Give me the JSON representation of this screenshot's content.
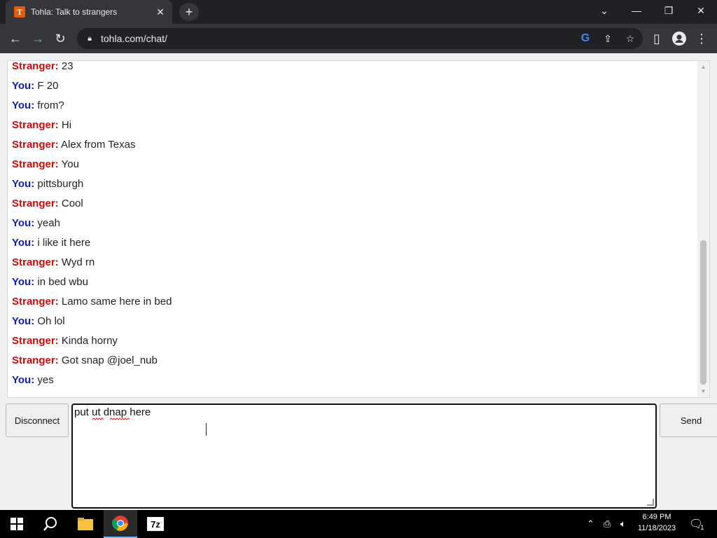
{
  "browser": {
    "tab_title": "Tohla: Talk to strangers",
    "favicon_letter": "T",
    "url": "tohla.com/chat/"
  },
  "chat": {
    "messages": [
      {
        "who": "stranger",
        "label": "Stranger:",
        "text": "23"
      },
      {
        "who": "you",
        "label": "You:",
        "text": "F 20"
      },
      {
        "who": "you",
        "label": "You:",
        "text": "from?"
      },
      {
        "who": "stranger",
        "label": "Stranger:",
        "text": "Hi"
      },
      {
        "who": "stranger",
        "label": "Stranger:",
        "text": "Alex from Texas"
      },
      {
        "who": "stranger",
        "label": "Stranger:",
        "text": "You"
      },
      {
        "who": "you",
        "label": "You:",
        "text": "pittsburgh"
      },
      {
        "who": "stranger",
        "label": "Stranger:",
        "text": "Cool"
      },
      {
        "who": "you",
        "label": "You:",
        "text": "yeah"
      },
      {
        "who": "you",
        "label": "You:",
        "text": "i like it here"
      },
      {
        "who": "stranger",
        "label": "Stranger:",
        "text": "Wyd rn"
      },
      {
        "who": "you",
        "label": "You:",
        "text": "in bed wbu"
      },
      {
        "who": "stranger",
        "label": "Stranger:",
        "text": "Lamo same here in bed"
      },
      {
        "who": "you",
        "label": "You:",
        "text": "Oh lol"
      },
      {
        "who": "stranger",
        "label": "Stranger:",
        "text": "Kinda horny"
      },
      {
        "who": "stranger",
        "label": "Stranger:",
        "text": "Got snap @joel_nub"
      },
      {
        "who": "you",
        "label": "You:",
        "text": "yes"
      }
    ],
    "disconnect_label": "Disconnect",
    "send_label": "Send",
    "input_value": "put ut dnap here"
  },
  "taskbar": {
    "time": "6:49 PM",
    "date": "11/18/2023",
    "notification_count": "1"
  }
}
